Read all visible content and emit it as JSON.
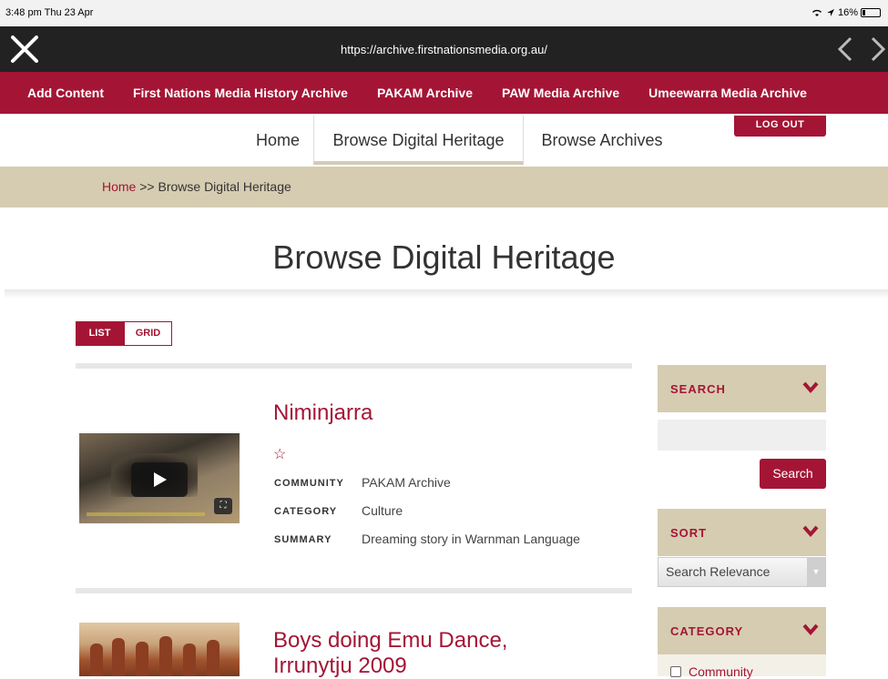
{
  "status_bar": {
    "time": "3:48 pm  Thu 23 Apr",
    "battery": "16%"
  },
  "browser": {
    "url": "https://archive.firstnationsmedia.org.au/"
  },
  "archive_nav": [
    "Add Content",
    "First Nations Media History Archive",
    "PAKAM Archive",
    "PAW Media Archive",
    "Umeewarra Media Archive"
  ],
  "main_nav": {
    "home": "Home",
    "browse_heritage": "Browse Digital Heritage",
    "browse_archives": "Browse Archives",
    "logout": "LOG OUT"
  },
  "breadcrumb": {
    "home": "Home",
    "separator": ">>",
    "current": "Browse Digital Heritage"
  },
  "page_title": "Browse Digital Heritage",
  "view_toggle": {
    "list": "LIST",
    "grid": "GRID"
  },
  "results": [
    {
      "title": "Niminjarra",
      "star": "☆",
      "community_label": "COMMUNITY",
      "community": "PAKAM Archive",
      "category_label": "CATEGORY",
      "category": "Culture",
      "summary_label": "SUMMARY",
      "summary": "Dreaming story in Warnman Language"
    },
    {
      "title_line1": "Boys doing Emu Dance,",
      "title_line2": "Irrunytju 2009"
    }
  ],
  "sidebar": {
    "search_heading": "SEARCH",
    "search_button": "Search",
    "sort_heading": "SORT",
    "sort_selected": "Search Relevance",
    "category_heading": "CATEGORY",
    "category_first_option": "Community"
  },
  "colors": {
    "brand": "#a41535",
    "tan": "#d6ccb1",
    "browser_bar": "#222222"
  }
}
